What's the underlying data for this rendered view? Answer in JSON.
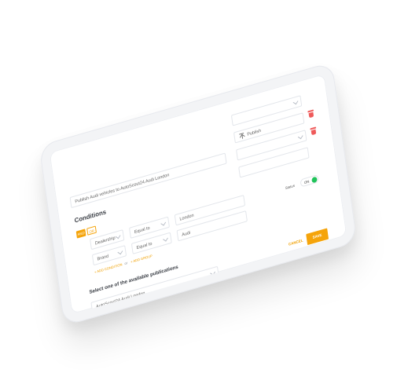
{
  "top_select": {
    "value": ""
  },
  "publish_button": {
    "label": "Publish"
  },
  "publication_name": {
    "value": "Publish Audi vehicles to AutoScout24 Audi London"
  },
  "conditions": {
    "title": "Conditions",
    "and_label": "AND",
    "or_label": "OR",
    "rows": [
      {
        "field": "Dealership",
        "operator": "Equal to",
        "value": "London"
      },
      {
        "field": "Brand",
        "operator": "Equal to",
        "value": "Audi"
      }
    ],
    "add_condition_label": "+ ADD CONDITION",
    "or_separator": "or",
    "add_group_label": "+ ADD GROUP"
  },
  "status": {
    "label": "Status",
    "value": "ON",
    "color": "#20c35a"
  },
  "actions": {
    "cancel_label": "CANCEL",
    "save_label": "SAVE",
    "save_color": "#f5a40b"
  },
  "publications": {
    "title": "Select one of the available publications",
    "selected": "AutoScout24 Audi London"
  },
  "colors": {
    "accent": "#f5a40b",
    "danger": "#ef5a5a",
    "success": "#20c35a"
  },
  "icons": {
    "publish": "publish-upload-icon",
    "delete": "trash-icon",
    "dropdown": "chevron-down-icon"
  }
}
